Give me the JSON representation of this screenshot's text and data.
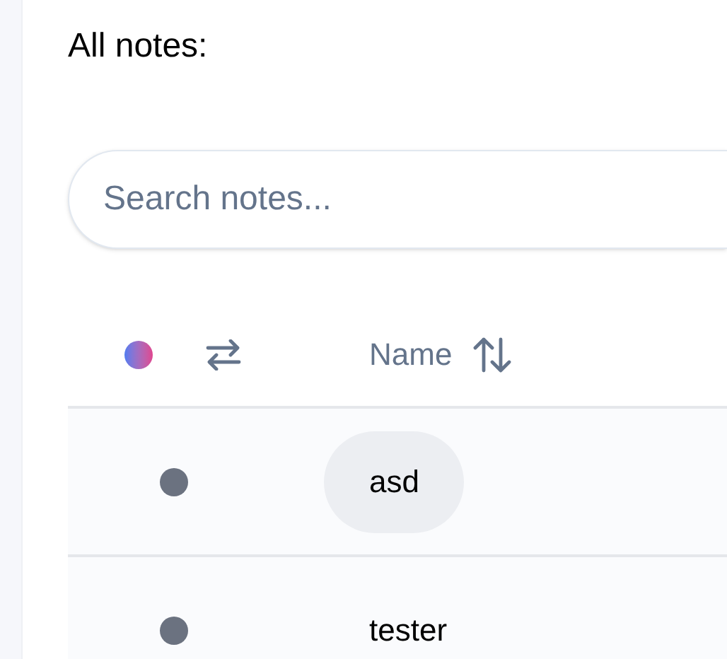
{
  "title": "All notes:",
  "search": {
    "placeholder": "Search notes..."
  },
  "table": {
    "columns": [
      {
        "label": "Name"
      }
    ],
    "rows": [
      {
        "name": "asd",
        "selected": true
      },
      {
        "name": "tester",
        "selected": false
      }
    ]
  }
}
